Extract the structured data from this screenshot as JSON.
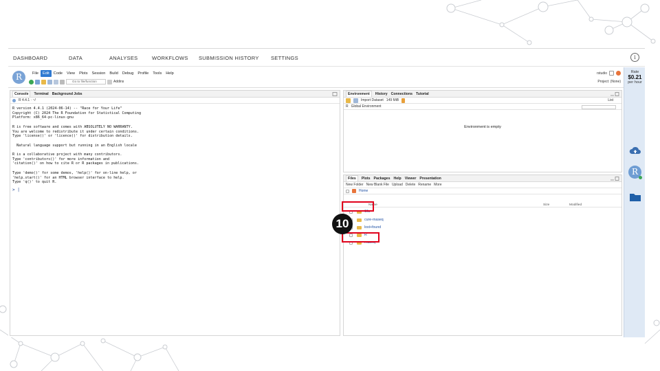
{
  "topnav": {
    "items": [
      "DASHBOARD",
      "DATA",
      "ANALYSES",
      "WORKFLOWS",
      "SUBMISSION HISTORY",
      "SETTINGS"
    ],
    "info_icon": "i"
  },
  "rstudio": {
    "avatar": "R",
    "menu": [
      "File",
      "Edit",
      "Code",
      "View",
      "Plots",
      "Session",
      "Build",
      "Debug",
      "Profile",
      "Tools",
      "Help"
    ],
    "active_menu": "Edit",
    "goto_placeholder": "Go to file/function",
    "addins": "Addins",
    "user": "rstudio",
    "project": "Project: (None)"
  },
  "console_pane": {
    "tabs": [
      "Console",
      "Terminal",
      "Background Jobs"
    ],
    "version_label": "R 4.4.1 · ~/",
    "startup_text": "R version 4.4.1 (2024-06-14) -- \"Race for Your Life\"\nCopyright (C) 2024 The R Foundation for Statistical Computing\nPlatform: x86_64-pc-linux-gnu\n\nR is free software and comes with ABSOLUTELY NO WARRANTY.\nYou are welcome to redistribute it under certain conditions.\nType 'license()' or 'licence()' for distribution details.\n\n  Natural language support but running in an English locale\n\nR is a collaborative project with many contributors.\nType 'contributors()' for more information and\n'citation()' on how to cite R or R packages in publications.\n\nType 'demo()' for some demos, 'help()' for on-line help, or\n'help.start()' for an HTML browser interface to help.\nType 'q()' to quit R.",
    "prompt": "> |"
  },
  "env_pane": {
    "tabs": [
      "Environment",
      "History",
      "Connections",
      "Tutorial"
    ],
    "import_dataset": "Import Dataset",
    "memory": "149 MiB",
    "list_view": "List",
    "r_selector": "R",
    "global_env": "Global Environment",
    "empty_message": "Environment is empty"
  },
  "files_pane": {
    "tabs": [
      "Files",
      "Plots",
      "Packages",
      "Help",
      "Viewer",
      "Presentation"
    ],
    "toolbar": [
      "New Folder",
      "New Blank File",
      "Upload",
      "Delete",
      "Rename",
      "More"
    ],
    "breadcrumb": "Home",
    "columns": [
      "Name",
      "Size",
      "Modified"
    ],
    "files": [
      "16s",
      "cure-rnaseq",
      "lost+found",
      "R",
      "rnaseq"
    ]
  },
  "annotation": {
    "step_number": "10",
    "highlight_color": "#e0001b"
  },
  "sidebar": {
    "rate_label": "Rate",
    "rate_value": "$0.21",
    "rate_unit": "per hour",
    "avatar": "R"
  }
}
